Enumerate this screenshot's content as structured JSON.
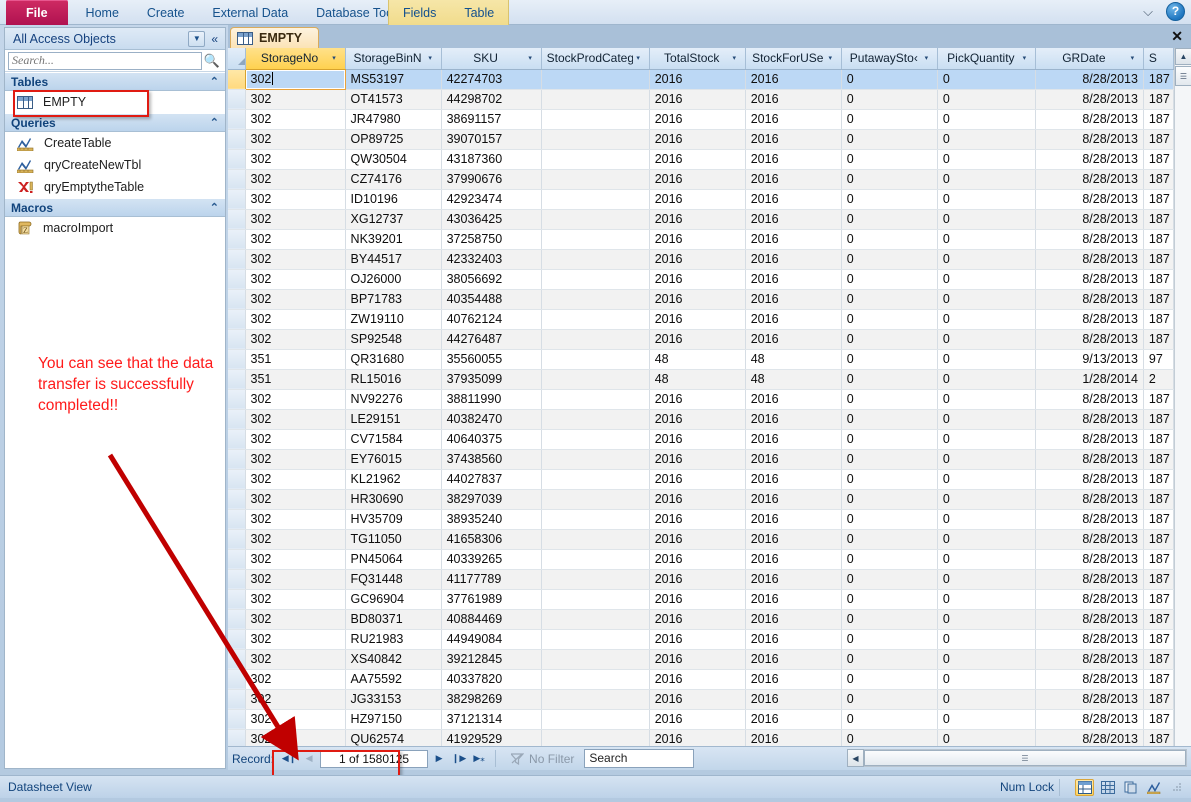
{
  "ribbon": {
    "tabs": [
      {
        "id": "file",
        "label": "File"
      },
      {
        "id": "home",
        "label": "Home"
      },
      {
        "id": "create",
        "label": "Create"
      },
      {
        "id": "external-data",
        "label": "External Data"
      },
      {
        "id": "database-tools",
        "label": "Database Tools"
      }
    ],
    "contextual_tabs": [
      {
        "id": "fields",
        "label": "Fields"
      },
      {
        "id": "table",
        "label": "Table"
      }
    ],
    "help_glyph": "?",
    "minimize_glyph": "⌵"
  },
  "navpane": {
    "title": "All Access Objects",
    "dropdown_glyph": "▼",
    "collapse_glyph": "«",
    "search_placeholder": "Search...",
    "groups": [
      {
        "name": "Tables",
        "collapse_glyph": "⌃",
        "items": [
          {
            "label": "EMPTY",
            "icon": "table-icon"
          }
        ]
      },
      {
        "name": "Queries",
        "collapse_glyph": "⌃",
        "items": [
          {
            "label": "CreateTable",
            "icon": "query-icon"
          },
          {
            "label": "qryCreateNewTbl",
            "icon": "query-icon"
          },
          {
            "label": "qryEmptytheTable",
            "icon": "delete-query-icon"
          }
        ]
      },
      {
        "name": "Macros",
        "collapse_glyph": "⌃",
        "items": [
          {
            "label": "macroImport",
            "icon": "macro-icon"
          }
        ]
      }
    ]
  },
  "annotation": {
    "text": "You can see that the data transfer is successfully completed!!",
    "color": "#ff1a1a"
  },
  "document": {
    "tab_label": "EMPTY",
    "close_glyph": "✕"
  },
  "datasheet": {
    "columns": [
      {
        "label": "StorageNo",
        "selected": true,
        "align": "left"
      },
      {
        "label": "StorageBinN",
        "selected": false,
        "align": "left"
      },
      {
        "label": "SKU",
        "selected": false,
        "align": "left"
      },
      {
        "label": "StockProdCateg‹",
        "selected": false,
        "align": "left"
      },
      {
        "label": "TotalStock",
        "selected": false,
        "align": "left"
      },
      {
        "label": "StockForUSe",
        "selected": false,
        "align": "left"
      },
      {
        "label": "PutawaySto‹",
        "selected": false,
        "align": "left"
      },
      {
        "label": "PickQuantity",
        "selected": false,
        "align": "left"
      },
      {
        "label": "GRDate",
        "selected": false,
        "align": "right"
      },
      {
        "label": "SC‹",
        "selected": false,
        "align": "left"
      }
    ],
    "dropdown_glyph": "▾",
    "editing_cell": {
      "row": 0,
      "col": 0,
      "value": "302"
    },
    "rows": [
      [
        "302",
        "MS53197",
        "42274703",
        "",
        "2016",
        "2016",
        "0",
        "0",
        "8/28/2013",
        "187"
      ],
      [
        "302",
        "OT41573",
        "44298702",
        "",
        "2016",
        "2016",
        "0",
        "0",
        "8/28/2013",
        "187"
      ],
      [
        "302",
        "JR47980",
        "38691157",
        "",
        "2016",
        "2016",
        "0",
        "0",
        "8/28/2013",
        "187"
      ],
      [
        "302",
        "OP89725",
        "39070157",
        "",
        "2016",
        "2016",
        "0",
        "0",
        "8/28/2013",
        "187"
      ],
      [
        "302",
        "QW30504",
        "43187360",
        "",
        "2016",
        "2016",
        "0",
        "0",
        "8/28/2013",
        "187"
      ],
      [
        "302",
        "CZ74176",
        "37990676",
        "",
        "2016",
        "2016",
        "0",
        "0",
        "8/28/2013",
        "187"
      ],
      [
        "302",
        "ID10196",
        "42923474",
        "",
        "2016",
        "2016",
        "0",
        "0",
        "8/28/2013",
        "187"
      ],
      [
        "302",
        "XG12737",
        "43036425",
        "",
        "2016",
        "2016",
        "0",
        "0",
        "8/28/2013",
        "187"
      ],
      [
        "302",
        "NK39201",
        "37258750",
        "",
        "2016",
        "2016",
        "0",
        "0",
        "8/28/2013",
        "187"
      ],
      [
        "302",
        "BY44517",
        "42332403",
        "",
        "2016",
        "2016",
        "0",
        "0",
        "8/28/2013",
        "187"
      ],
      [
        "302",
        "OJ26000",
        "38056692",
        "",
        "2016",
        "2016",
        "0",
        "0",
        "8/28/2013",
        "187"
      ],
      [
        "302",
        "BP71783",
        "40354488",
        "",
        "2016",
        "2016",
        "0",
        "0",
        "8/28/2013",
        "187"
      ],
      [
        "302",
        "ZW19110",
        "40762124",
        "",
        "2016",
        "2016",
        "0",
        "0",
        "8/28/2013",
        "187"
      ],
      [
        "302",
        "SP92548",
        "44276487",
        "",
        "2016",
        "2016",
        "0",
        "0",
        "8/28/2013",
        "187"
      ],
      [
        "351",
        "QR31680",
        "35560055",
        "",
        "48",
        "48",
        "0",
        "0",
        "9/13/2013",
        "97"
      ],
      [
        "351",
        "RL15016",
        "37935099",
        "",
        "48",
        "48",
        "0",
        "0",
        "1/28/2014",
        "2"
      ],
      [
        "302",
        "NV92276",
        "38811990",
        "",
        "2016",
        "2016",
        "0",
        "0",
        "8/28/2013",
        "187"
      ],
      [
        "302",
        "LE29151",
        "40382470",
        "",
        "2016",
        "2016",
        "0",
        "0",
        "8/28/2013",
        "187"
      ],
      [
        "302",
        "CV71584",
        "40640375",
        "",
        "2016",
        "2016",
        "0",
        "0",
        "8/28/2013",
        "187"
      ],
      [
        "302",
        "EY76015",
        "37438560",
        "",
        "2016",
        "2016",
        "0",
        "0",
        "8/28/2013",
        "187"
      ],
      [
        "302",
        "KL21962",
        "44027837",
        "",
        "2016",
        "2016",
        "0",
        "0",
        "8/28/2013",
        "187"
      ],
      [
        "302",
        "HR30690",
        "38297039",
        "",
        "2016",
        "2016",
        "0",
        "0",
        "8/28/2013",
        "187"
      ],
      [
        "302",
        "HV35709",
        "38935240",
        "",
        "2016",
        "2016",
        "0",
        "0",
        "8/28/2013",
        "187"
      ],
      [
        "302",
        "TG11050",
        "41658306",
        "",
        "2016",
        "2016",
        "0",
        "0",
        "8/28/2013",
        "187"
      ],
      [
        "302",
        "PN45064",
        "40339265",
        "",
        "2016",
        "2016",
        "0",
        "0",
        "8/28/2013",
        "187"
      ],
      [
        "302",
        "FQ31448",
        "41177789",
        "",
        "2016",
        "2016",
        "0",
        "0",
        "8/28/2013",
        "187"
      ],
      [
        "302",
        "GC96904",
        "37761989",
        "",
        "2016",
        "2016",
        "0",
        "0",
        "8/28/2013",
        "187"
      ],
      [
        "302",
        "BD80371",
        "40884469",
        "",
        "2016",
        "2016",
        "0",
        "0",
        "8/28/2013",
        "187"
      ],
      [
        "302",
        "RU21983",
        "44949084",
        "",
        "2016",
        "2016",
        "0",
        "0",
        "8/28/2013",
        "187"
      ],
      [
        "302",
        "XS40842",
        "39212845",
        "",
        "2016",
        "2016",
        "0",
        "0",
        "8/28/2013",
        "187"
      ],
      [
        "302",
        "AA75592",
        "40337820",
        "",
        "2016",
        "2016",
        "0",
        "0",
        "8/28/2013",
        "187"
      ],
      [
        "302",
        "JG33153",
        "38298269",
        "",
        "2016",
        "2016",
        "0",
        "0",
        "8/28/2013",
        "187"
      ],
      [
        "302",
        "HZ97150",
        "37121314",
        "",
        "2016",
        "2016",
        "0",
        "0",
        "8/28/2013",
        "187"
      ],
      [
        "302",
        "QU62574",
        "41929529",
        "",
        "2016",
        "2016",
        "0",
        "0",
        "8/28/2013",
        "187"
      ]
    ]
  },
  "recordnav": {
    "label": "Record:",
    "first_glyph": "◀❙",
    "prev_glyph": "◀",
    "value": "1 of 1580125",
    "next_glyph": "▶",
    "last_glyph": "❙▶",
    "new_glyph": "▶⁎",
    "filter_label": "No Filter",
    "filter_icon": "filter-icon",
    "search_placeholder": "Search",
    "search_value": "Search"
  },
  "statusbar": {
    "view_label": "Datasheet View",
    "num_lock": "Num Lock",
    "view_buttons": [
      {
        "name": "datasheet-view-button",
        "active": true
      },
      {
        "name": "pivottable-view-button",
        "active": false
      },
      {
        "name": "pivotchart-view-button",
        "active": false
      },
      {
        "name": "design-view-button",
        "active": false
      }
    ]
  }
}
